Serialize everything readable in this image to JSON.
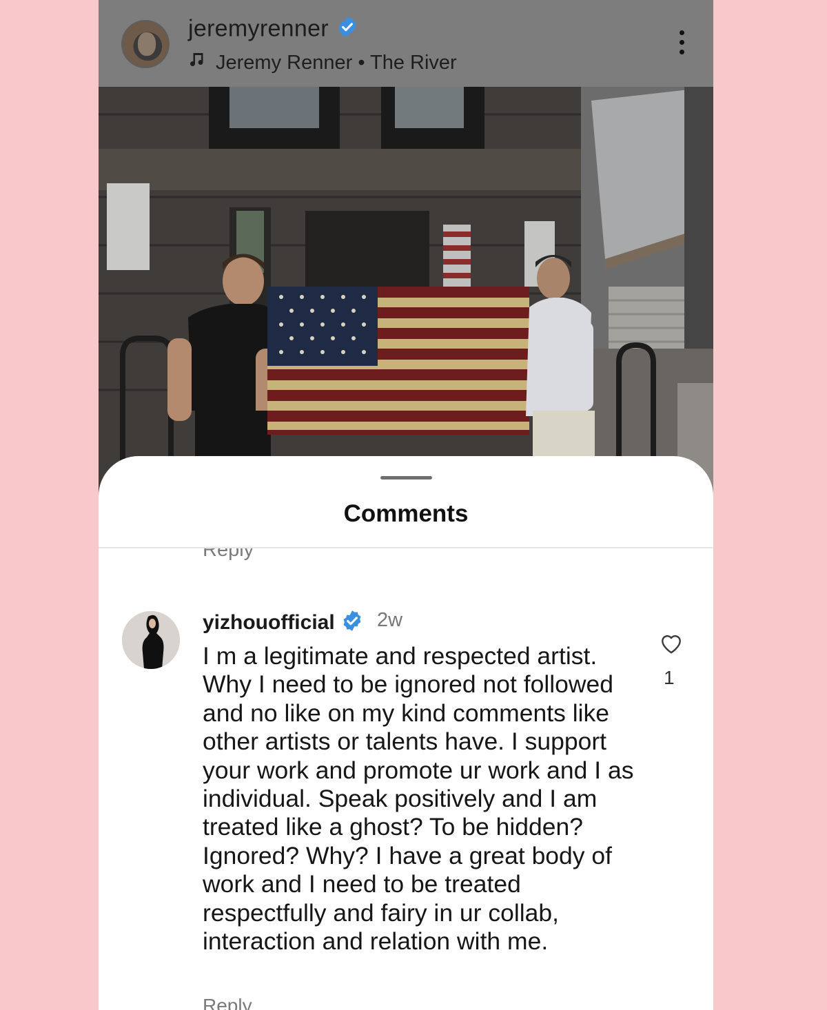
{
  "header": {
    "username": "jeremyrenner",
    "audio_artist": "Jeremy Renner",
    "audio_separator": "•",
    "audio_title": "The River",
    "more_icon": "more-vertical-icon"
  },
  "sheet": {
    "title": "Comments",
    "previous_reply_label": "Reply"
  },
  "comment": {
    "username": "yizhouofficial",
    "time": "2w",
    "text": "I m a legitimate and respected artist. Why I need to be ignored not followed and no like on my kind comments like other artists or talents have. I support your work and promote ur work and I as individual. Speak positively and I am treated like a ghost? To be hidden? Ignored? Why? I have a great body of work and I need to be treated respectfully and fairy in ur collab, interaction and relation with me.",
    "likes": "1",
    "reply_label": "Reply"
  },
  "colors": {
    "background": "#f8c8cb",
    "verified_badge": "#3b8fe0",
    "sheet": "#ffffff"
  }
}
